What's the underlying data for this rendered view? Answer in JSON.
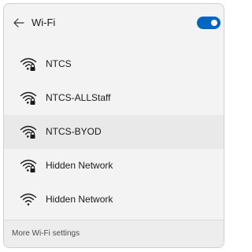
{
  "header": {
    "title": "Wi-Fi",
    "back_icon": "back-arrow-icon",
    "toggle_state": "on",
    "accent_color": "#0067c0"
  },
  "networks": [
    {
      "name": "NTCS",
      "icon": "wifi-secured-icon",
      "secured": true
    },
    {
      "name": "NTCS-ALLStaff",
      "icon": "wifi-secured-icon",
      "secured": true
    },
    {
      "name": "NTCS-BYOD",
      "icon": "wifi-secured-icon",
      "secured": true,
      "hovered": true
    },
    {
      "name": "Hidden Network",
      "icon": "wifi-secured-icon",
      "secured": true
    },
    {
      "name": "Hidden Network",
      "icon": "wifi-icon",
      "secured": false
    }
  ],
  "footer": {
    "link_label": "More Wi-Fi settings"
  }
}
